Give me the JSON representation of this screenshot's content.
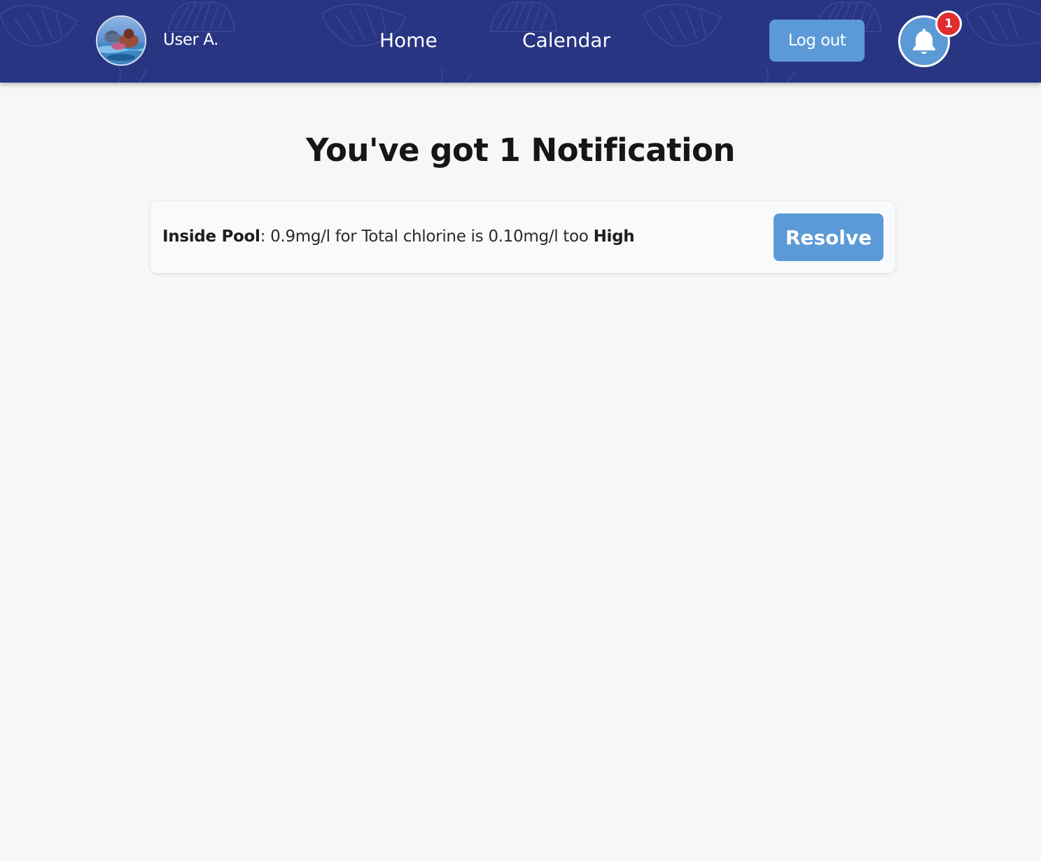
{
  "header": {
    "user_name": "User A.",
    "nav": {
      "home_label": "Home",
      "calendar_label": "Calendar"
    },
    "logout_label": "Log out",
    "notification_count": "1"
  },
  "main": {
    "title_prefix": "You've got",
    "title_count": "1",
    "title_suffix": "Notification",
    "notifications": [
      {
        "location": "Inside Pool",
        "separator": ":",
        "message": "0.9mg/l for Total chlorine is 0.10mg/l too",
        "level": "High",
        "action_label": "Resolve"
      }
    ]
  },
  "colors": {
    "header_bg": "#283583",
    "accent": "#5b9ad6",
    "badge": "#e02c2c",
    "page_bg": "#f7f7f7"
  },
  "icons": {
    "avatar": "avatar-image",
    "bell": "bell-icon"
  }
}
